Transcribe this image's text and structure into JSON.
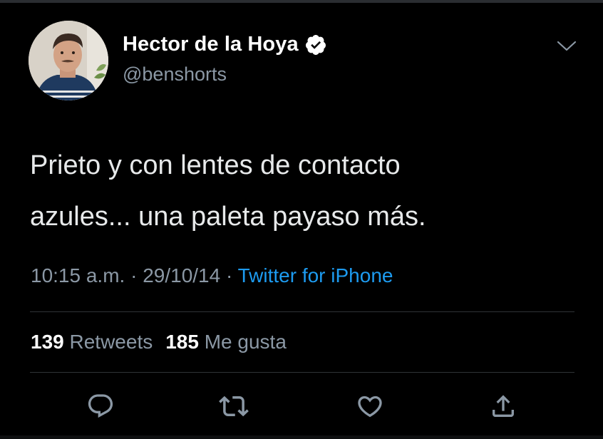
{
  "tweet": {
    "author": {
      "display_name": "Hector de la Hoya",
      "handle": "@benshorts",
      "verified_icon": "verified-badge-icon",
      "avatar": "avatar"
    },
    "text": "Prieto y con lentes de contacto\nazules... una paleta payaso más.",
    "time": "10:15 a.m.",
    "date": "29/10/14",
    "separator": "·",
    "source": "Twitter for iPhone",
    "stats": {
      "retweets_count": "139",
      "retweets_label": "Retweets",
      "likes_count": "185",
      "likes_label": "Me gusta"
    },
    "actions": [
      "reply-icon",
      "retweet-icon",
      "like-icon",
      "share-icon"
    ]
  },
  "colors": {
    "background": "#000000",
    "text_primary": "#ffffff",
    "text_secondary": "#8b98a5",
    "link": "#1d9bf0",
    "divider": "#2f3336"
  }
}
